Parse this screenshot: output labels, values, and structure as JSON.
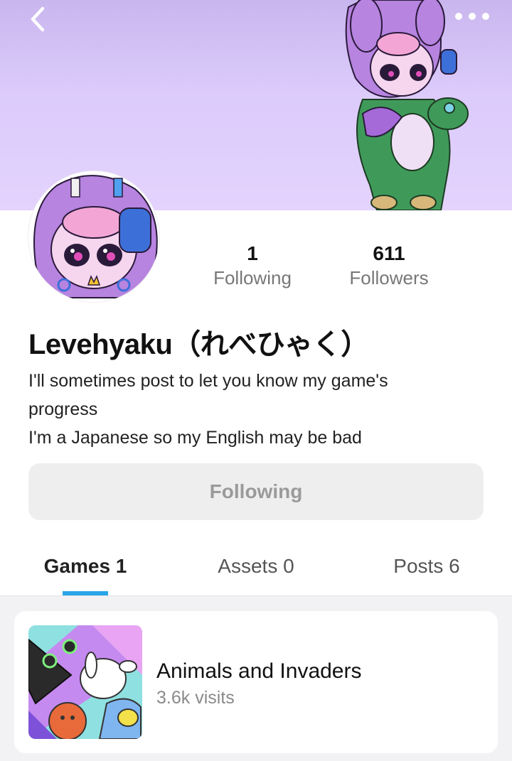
{
  "header": {
    "back_icon": "chevron-left-icon",
    "more_icon": "more-dots-icon"
  },
  "profile": {
    "stats": {
      "following_count": "1",
      "following_label": "Following",
      "followers_count": "611",
      "followers_label": "Followers"
    },
    "username": "Levehyaku（れべひゃく）",
    "bio_lines": [
      "I'll sometimes post to let you know my game's",
      "progress",
      "I'm a Japanese so my English may be bad"
    ],
    "follow_button_label": "Following"
  },
  "tabs": [
    {
      "label": "Games 1",
      "active": true
    },
    {
      "label": "Assets 0",
      "active": false
    },
    {
      "label": "Posts 6",
      "active": false
    }
  ],
  "games": [
    {
      "title": "Animals and Invaders",
      "visits": "3.6k visits"
    }
  ],
  "colors": {
    "banner": "#dccbfb",
    "tab_indicator": "#2aa4e8",
    "follow_button_bg": "#eeeeef",
    "follow_button_text": "#9a9a9a"
  }
}
